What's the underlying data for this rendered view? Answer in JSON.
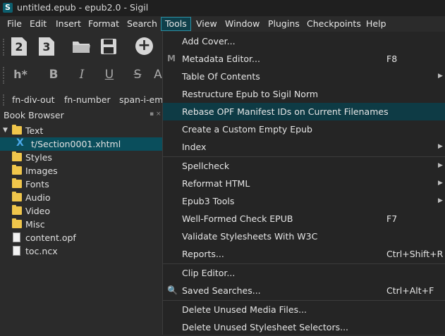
{
  "window": {
    "title": "untitled.epub - epub2.0 - Sigil",
    "app_icon_letter": "S"
  },
  "menubar": [
    {
      "label": "File",
      "active": false
    },
    {
      "label": "Edit",
      "active": false
    },
    {
      "label": "Insert",
      "active": false
    },
    {
      "label": "Format",
      "active": false
    },
    {
      "label": "Search",
      "active": false
    },
    {
      "label": "Tools",
      "active": true
    },
    {
      "label": "View",
      "active": false
    },
    {
      "label": "Window",
      "active": false
    },
    {
      "label": "Plugins",
      "active": false
    },
    {
      "label": "Checkpoints",
      "active": false
    },
    {
      "label": "Help",
      "active": false
    }
  ],
  "toolbar1": {
    "icons": [
      "heading-2-icon",
      "heading-3-icon",
      "open-folder-icon",
      "save-icon",
      "add-circle-icon"
    ],
    "glyphs": {
      "h2": "2",
      "h3": "3",
      "add": "+"
    }
  },
  "toolbar2": {
    "heading": "h*",
    "bold": "B",
    "italic": "I",
    "underline": "U",
    "strike": "S",
    "more": "A"
  },
  "clips": [
    "fn-div-out",
    "fn-number",
    "span-i-em"
  ],
  "book_browser": {
    "title": "Book Browser",
    "pin": "▪ ×",
    "items": [
      {
        "label": "Text",
        "type": "folder",
        "expanded": true,
        "level": 0
      },
      {
        "label": "t/Section0001.xhtml",
        "type": "xhtml",
        "level": 1,
        "selected": true
      },
      {
        "label": "Styles",
        "type": "folder",
        "level": 0
      },
      {
        "label": "Images",
        "type": "folder",
        "level": 0
      },
      {
        "label": "Fonts",
        "type": "folder",
        "level": 0
      },
      {
        "label": "Audio",
        "type": "folder",
        "level": 0
      },
      {
        "label": "Video",
        "type": "folder",
        "level": 0
      },
      {
        "label": "Misc",
        "type": "folder",
        "level": 0
      },
      {
        "label": "content.opf",
        "type": "file",
        "level": 0
      },
      {
        "label": "toc.ncx",
        "type": "file",
        "level": 0
      }
    ]
  },
  "tools_menu": [
    {
      "label": "Add Cover...",
      "shortcut": "",
      "submenu": false
    },
    {
      "label": "Metadata Editor...",
      "shortcut": "F8",
      "submenu": false,
      "icon": "M"
    },
    {
      "label": "Table Of Contents",
      "shortcut": "",
      "submenu": true
    },
    {
      "label": "Restructure Epub to Sigil Norm",
      "shortcut": "",
      "submenu": false
    },
    {
      "label": "Rebase OPF Manifest IDs on Current Filenames",
      "shortcut": "",
      "submenu": false,
      "highlight": true
    },
    {
      "label": "Create a Custom Empty Epub",
      "shortcut": "",
      "submenu": false
    },
    {
      "label": "Index",
      "shortcut": "",
      "submenu": true
    },
    {
      "label": "Spellcheck",
      "shortcut": "",
      "submenu": true
    },
    {
      "label": "Reformat HTML",
      "shortcut": "",
      "submenu": true
    },
    {
      "label": "Epub3 Tools",
      "shortcut": "",
      "submenu": true
    },
    {
      "label": "Well-Formed Check EPUB",
      "shortcut": "F7",
      "submenu": false
    },
    {
      "label": "Validate Stylesheets With W3C",
      "shortcut": "",
      "submenu": false
    },
    {
      "label": "Reports...",
      "shortcut": "Ctrl+Shift+R",
      "submenu": false
    },
    {
      "label": "Clip Editor...",
      "shortcut": "",
      "submenu": false
    },
    {
      "label": "Saved Searches...",
      "shortcut": "Ctrl+Alt+F",
      "submenu": false,
      "icon": "🔍"
    },
    {
      "label": "Delete Unused Media Files...",
      "shortcut": "",
      "submenu": false
    },
    {
      "label": "Delete Unused Stylesheet Selectors...",
      "shortcut": "",
      "submenu": false
    }
  ],
  "submenu_arrow": "▶"
}
